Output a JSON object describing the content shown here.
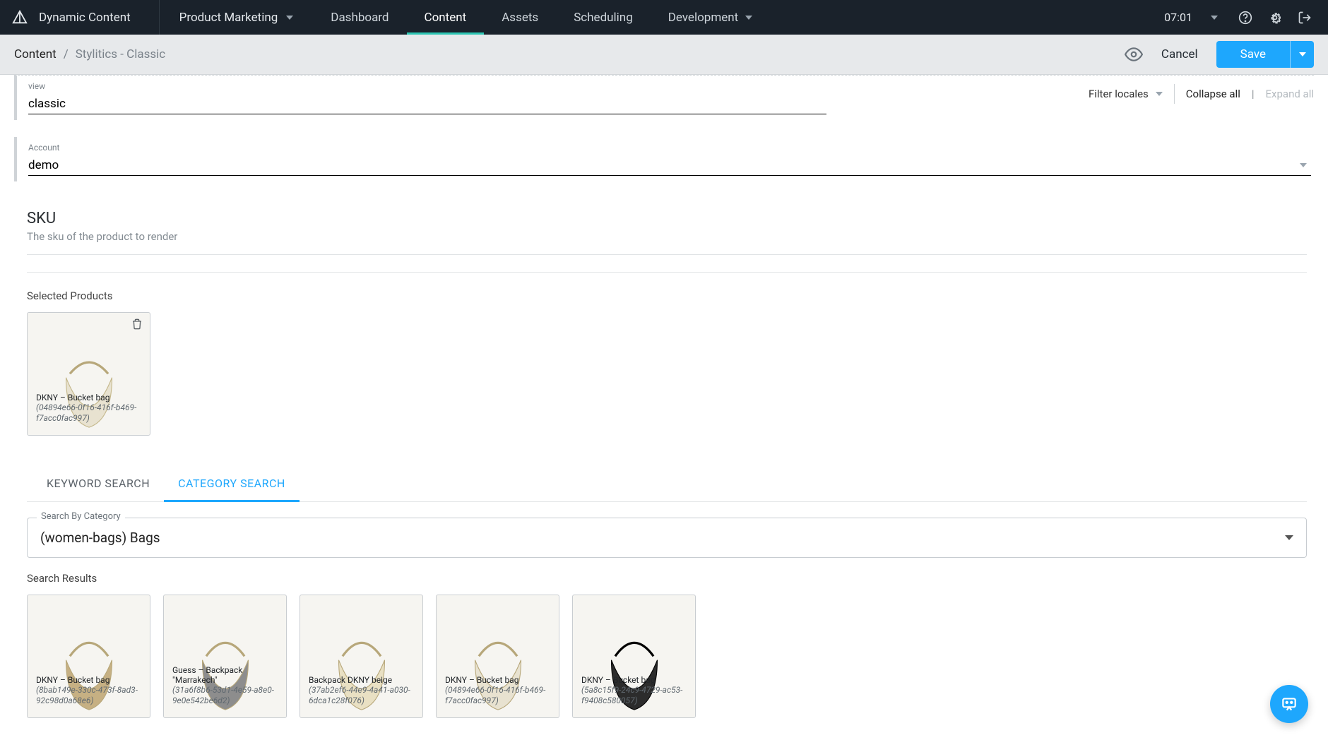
{
  "topnav": {
    "brand": "Dynamic Content",
    "hub": "Product Marketing",
    "links": {
      "dashboard": "Dashboard",
      "content": "Content",
      "assets": "Assets",
      "scheduling": "Scheduling",
      "development": "Development"
    },
    "time": "07:01"
  },
  "subhead": {
    "root": "Content",
    "sep": "/",
    "leaf": "Stylitics - Classic",
    "cancel": "Cancel",
    "save": "Save"
  },
  "localesBar": {
    "filter": "Filter locales",
    "collapse": "Collapse all",
    "pipe": "|",
    "expand": "Expand all"
  },
  "fields": {
    "viewLabel": "view",
    "viewValue": "classic",
    "accountLabel": "Account",
    "accountValue": "demo"
  },
  "sku": {
    "title": "SKU",
    "desc": "The sku of the product to render",
    "selectedLabel": "Selected Products",
    "selected": {
      "name": "DKNY – Bucket bag",
      "id": "(04894e66-0f16-416f-b469-f7acc0fac997)"
    }
  },
  "tabs": {
    "keyword": "Keyword Search",
    "category": "Category Search"
  },
  "category": {
    "legend": "Search By Category",
    "value": "(women-bags) Bags"
  },
  "results": {
    "label": "Search Results",
    "items": [
      {
        "name": "DKNY – Bucket bag",
        "id": "(8bab149e-330c-473f-8ad3-92c98d0a68e6)",
        "color": "tan"
      },
      {
        "name": "Guess – Backpack \"Marrakech\"",
        "id": "(31a6f8b6-53d1-4e59-a8e0-9e0e542be6d2)",
        "color": "grey"
      },
      {
        "name": "Backpack DKNY beige",
        "id": "(37ab2ef6-44e9-4a41-a030-6dca1c28f076)",
        "color": "beige"
      },
      {
        "name": "DKNY – Bucket bag",
        "id": "(04894e66-0f16-416f-b469-f7acc0fac997)",
        "color": "cream"
      },
      {
        "name": "DKNY – Bucket bag",
        "id": "(5a8c15f9-24c9-4729-ac53-f9408c580057)",
        "color": "black"
      }
    ]
  }
}
